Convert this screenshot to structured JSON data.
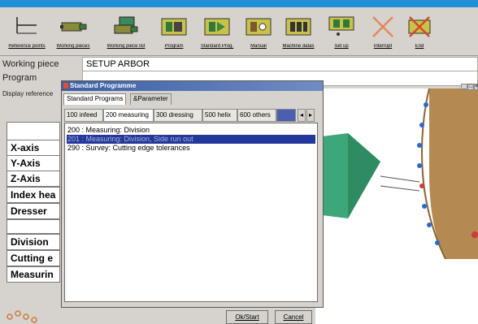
{
  "toolbar": {
    "items": [
      {
        "label": "Reference points",
        "icon": "reference-points-icon"
      },
      {
        "label": "Working pieces",
        "icon": "working-pieces-icon"
      },
      {
        "label": "Working piece list",
        "icon": "working-piece-list-icon"
      },
      {
        "label": "Program",
        "icon": "program-icon"
      },
      {
        "label": "Standard Prog.",
        "icon": "standard-prog-icon"
      },
      {
        "label": "Manual",
        "icon": "manual-icon"
      },
      {
        "label": "Machine datas",
        "icon": "machine-datas-icon"
      },
      {
        "label": "Set up",
        "icon": "set-up-icon"
      },
      {
        "label": "Interrupt",
        "icon": "interrupt-icon"
      },
      {
        "label": "End",
        "icon": "end-icon"
      }
    ]
  },
  "header": {
    "working_piece_label": "Working piece",
    "working_piece_value": "SETUP ARBOR",
    "program_label": "Program",
    "display_reference_label": "Display reference"
  },
  "axes": {
    "items": [
      "X-axis",
      "Y-Axis",
      "Z-Axis",
      "Index hea",
      "Dresser",
      "Division",
      "Cutting e",
      "Measurin"
    ]
  },
  "dialog": {
    "title": "Standard Programme",
    "window_tabs": [
      "Standard Programs",
      "&Parameter"
    ],
    "category_tabs": [
      "100 infeed",
      "200 measuring",
      "300 dressing",
      "500 helix",
      "600 others"
    ],
    "list_items": [
      "200 : Measuring: Division",
      "201 : Measuring: Division, Side run out",
      "290 : Survey: Cutting edge tolerances"
    ],
    "ok_label": "Ok/Start",
    "cancel_label": "Cancel"
  },
  "window_controls": [
    "_",
    "□",
    "×"
  ],
  "colors": {
    "accent": "#1f8fd6",
    "selection": "#23389a",
    "titlebar": "#3c5fa3",
    "tool_body": "#3ea779",
    "wheel": "#b48a52"
  }
}
